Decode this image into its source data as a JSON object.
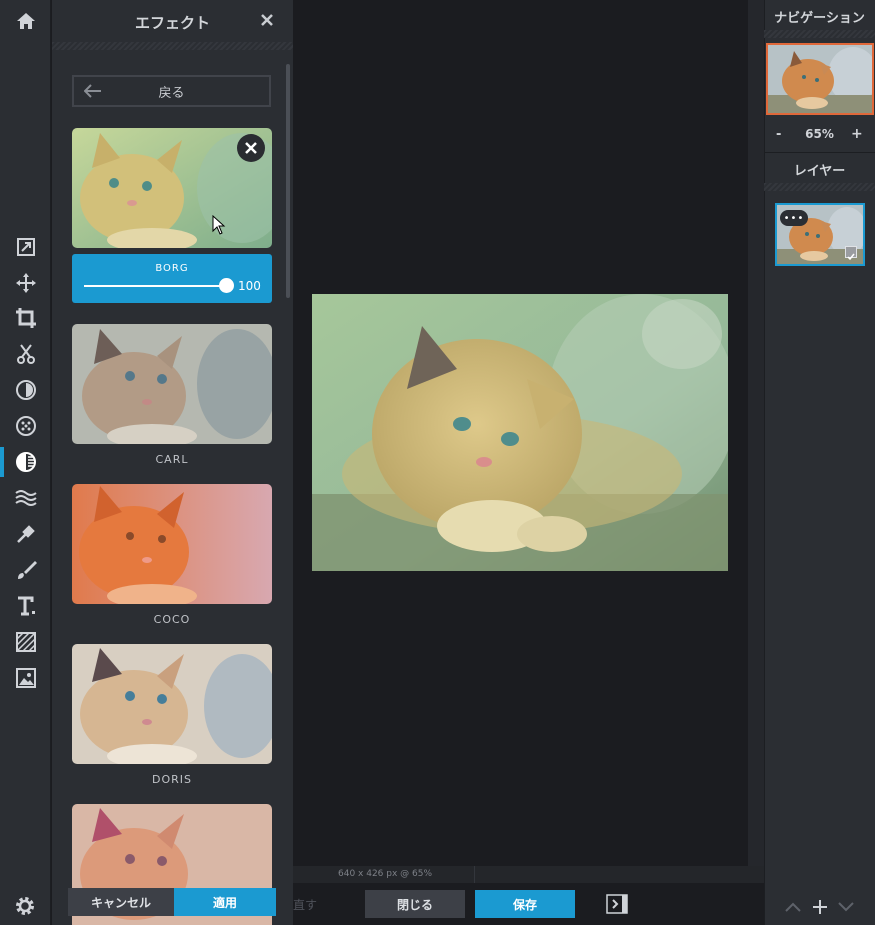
{
  "effects_panel": {
    "title": "エフェクト",
    "back_label": "戻る",
    "active_effect": {
      "name": "BORG",
      "value": "100",
      "value_fraction": 1.0
    },
    "effects": [
      {
        "name": "CARL"
      },
      {
        "name": "COCO"
      },
      {
        "name": "DORIS"
      }
    ],
    "cancel_label": "キャンセル",
    "apply_label": "適用"
  },
  "toolbar": {
    "tools": [
      "home-icon",
      "adjust-icon",
      "move-icon",
      "crop-icon",
      "cut-icon",
      "exposure-icon",
      "filter-icon",
      "effects-icon",
      "distort-icon",
      "picker-icon",
      "brush-icon",
      "text-icon",
      "pattern-icon",
      "image-icon",
      "settings-icon"
    ],
    "active_tool": "effects-icon"
  },
  "canvas": {
    "status": "640 x 426 px @ 65%"
  },
  "bottom_bar": {
    "redo_label": "直す",
    "close_label": "閉じる",
    "save_label": "保存"
  },
  "navigation": {
    "title": "ナビゲーション",
    "zoom_minus": "-",
    "zoom": "65%",
    "zoom_plus": "+"
  },
  "layers": {
    "title": "レイヤー",
    "menu": "•••"
  },
  "colors": {
    "accent": "#1b9ad1",
    "panel": "#2b2e33",
    "canvas": "#1b1c20",
    "nav_border": "#e0683a"
  }
}
